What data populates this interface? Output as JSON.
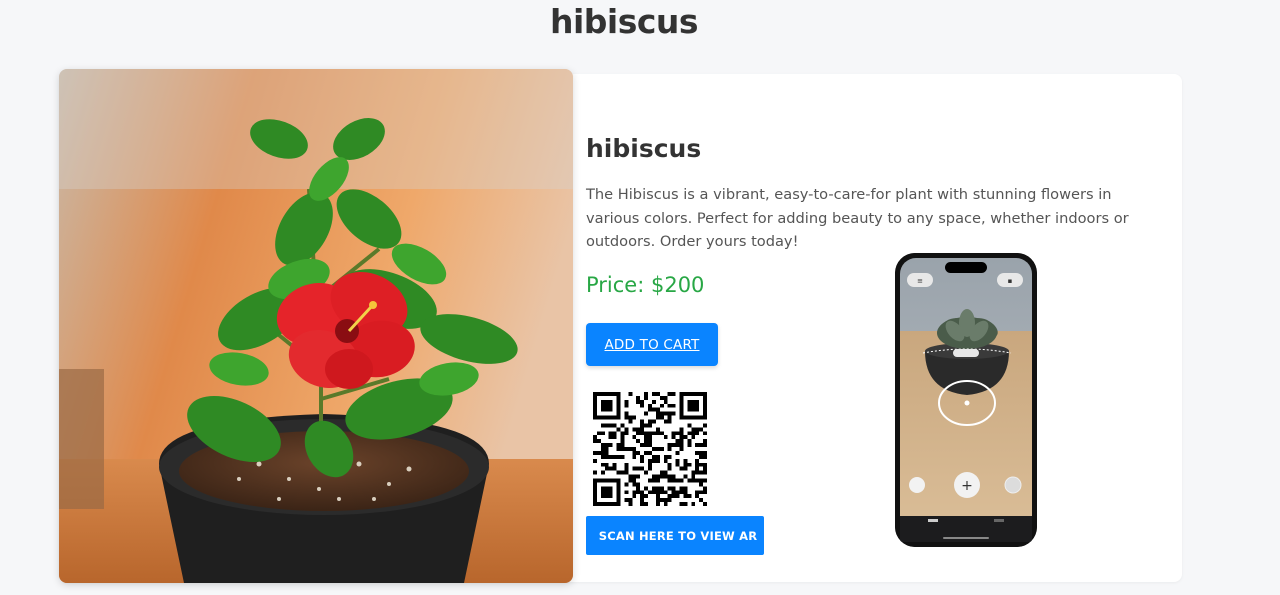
{
  "page": {
    "title": "hibiscus"
  },
  "product": {
    "name": "hibiscus",
    "description": "The Hibiscus is a vibrant, easy-to-care-for plant with stunning flowers in various colors. Perfect for adding beauty to any space, whether indoors or outdoors. Order yours today!",
    "price": "Price: $200",
    "add_to_cart_label": "ADD TO CART",
    "scan_ar_label": "SCAN HERE TO VIEW AR"
  },
  "colors": {
    "accent": "#0a84ff",
    "price": "#28a745"
  }
}
